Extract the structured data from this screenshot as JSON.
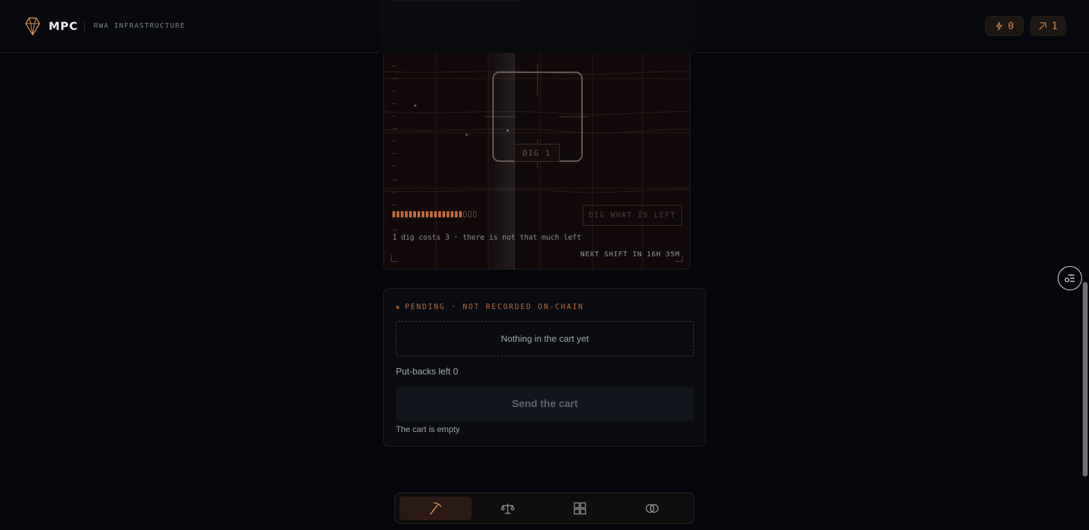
{
  "header": {
    "brand": "MPC",
    "subtitle": "RWA INFRASTRUCTURE",
    "logo_icon": "gem-icon",
    "energy_count": "0",
    "energy_icon": "lightning-icon",
    "picks_count": "1",
    "picks_icon": "pickaxe-icon"
  },
  "mine": {
    "dig_label": "DIG 1",
    "dig_remaining_button": "DIG WHAT IS LEFT",
    "charge_meter": {
      "filled": 17,
      "total": 20
    },
    "empty_marks": "000",
    "cost_note": "1 dig costs 3 · there is not that much left",
    "next_shift": "NEXT SHIFT IN 16H 35M"
  },
  "cart": {
    "status_label": "PENDING · NOT RECORDED ON-CHAIN",
    "empty_message": "Nothing in the cart yet",
    "putbacks_label": "Put-backs left 0",
    "send_button": "Send the cart",
    "status_text": "The cart is empty"
  },
  "bottom_nav": {
    "items": [
      {
        "icon": "pickaxe-icon",
        "active": true
      },
      {
        "icon": "scales-icon",
        "active": false
      },
      {
        "icon": "grid-icon",
        "active": false
      },
      {
        "icon": "rings-icon",
        "active": false
      }
    ]
  },
  "colors": {
    "accent": "#d98a4d",
    "background": "#05070c",
    "mine_bg": "#120a0a"
  }
}
